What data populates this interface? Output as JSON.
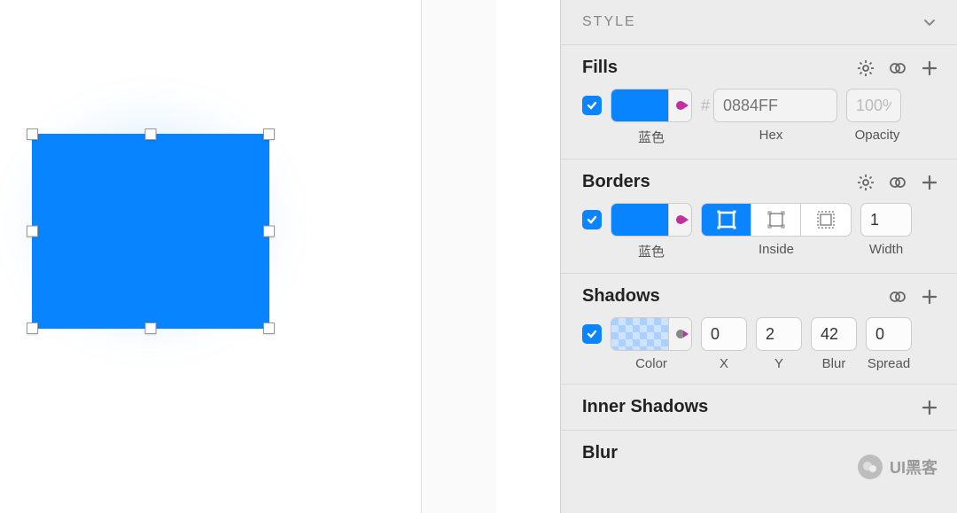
{
  "header": {
    "style_label": "STYLE"
  },
  "fills": {
    "title": "Fills",
    "checked": true,
    "swatch_color": "#0884FF",
    "swatch_label": "蓝色",
    "hex_prefix": "#",
    "hex_placeholder": "0884FF",
    "hex_label": "Hex",
    "opacity_value": "100%",
    "opacity_label": "Opacity"
  },
  "borders": {
    "title": "Borders",
    "checked": true,
    "swatch_color": "#0884FF",
    "swatch_label": "蓝色",
    "position_label": "Inside",
    "width_value": "1",
    "width_label": "Width"
  },
  "shadows": {
    "title": "Shadows",
    "checked": true,
    "color_label": "Color",
    "x": "0",
    "x_label": "X",
    "y": "2",
    "y_label": "Y",
    "blur": "42",
    "blur_label": "Blur",
    "spread": "0",
    "spread_label": "Spread"
  },
  "inner_shadows": {
    "title": "Inner Shadows"
  },
  "blur": {
    "title": "Blur"
  },
  "watermark": {
    "text": "UI黑客"
  }
}
